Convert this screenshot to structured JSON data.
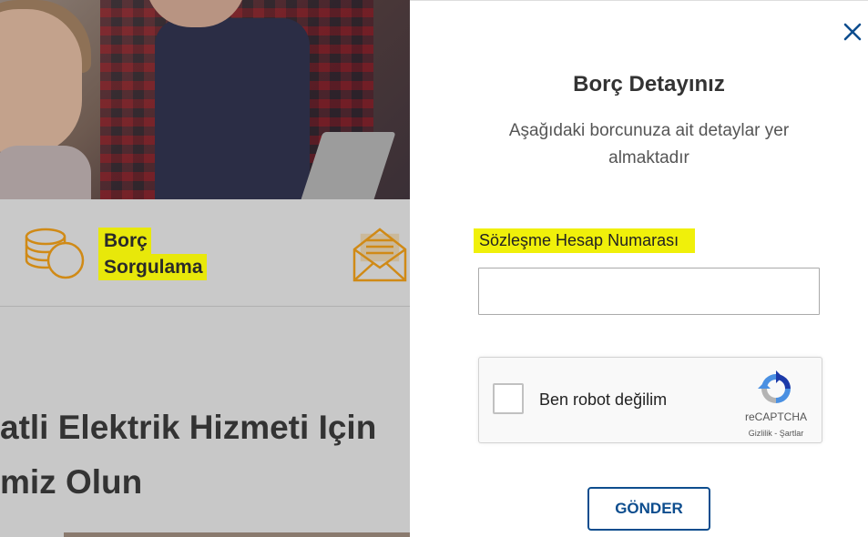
{
  "background": {
    "service": {
      "label_line1": "Borç",
      "label_line2": "Sorgulama",
      "icon": "coins-icon",
      "secondary_icon": "envelope-icon"
    },
    "headline": {
      "line1": "atli Elektrik Hizmeti Için",
      "line2": "miz Olun"
    }
  },
  "modal": {
    "close_icon": "close-icon",
    "title": "Borç Detayınız",
    "subtitle": "Aşağıdaki borcunuza ait detaylar yer almaktadır",
    "field_label": "Sözleşme Hesap Numarası",
    "field_value": "",
    "recaptcha": {
      "label": "Ben robot değilim",
      "brand": "reCAPTCHA",
      "terms": "Gizlilik - Şartlar",
      "checked": false
    },
    "submit_label": "GÖNDER"
  },
  "colors": {
    "accent": "#0d4d8e",
    "icon_orange": "#d08a16",
    "highlight": "#f0f00a"
  }
}
